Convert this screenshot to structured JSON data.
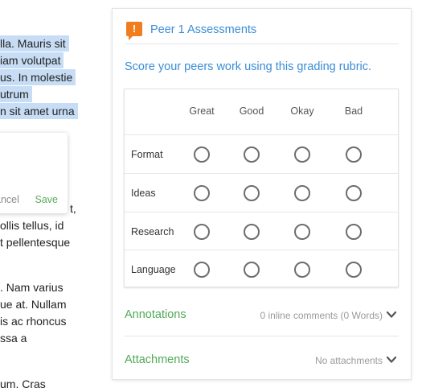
{
  "document": {
    "lines": [
      {
        "text": "lla. Mauris sit",
        "highlight": true
      },
      {
        "text": "iam volutpat",
        "highlight": true
      },
      {
        "text": "us. In molestie",
        "highlight": true
      },
      {
        "text": "utrum",
        "highlight": true
      },
      {
        "text": "n sit amet urna",
        "highlight": true
      },
      {
        "text": "t,",
        "highlight": false
      },
      {
        "text": "ollis tellus, id",
        "highlight": false
      },
      {
        "text": "t pellentesque",
        "highlight": false
      },
      {
        "text": ". Nam varius",
        "highlight": false
      },
      {
        "text": "ue at. Nullam",
        "highlight": false
      },
      {
        "text": "is ac rhoncus",
        "highlight": false
      },
      {
        "text": "ssa a",
        "highlight": false
      },
      {
        "text": "um. Cras",
        "highlight": false
      }
    ]
  },
  "comment_popup": {
    "cancel_label": "ancel",
    "save_label": "Save"
  },
  "card": {
    "title": "Peer 1 Assessments",
    "instructions": "Score your peers work using this grading rubric.",
    "rubric": {
      "columns": [
        "Great",
        "Good",
        "Okay",
        "Bad"
      ],
      "rows": [
        "Format",
        "Ideas",
        "Research",
        "Language"
      ]
    },
    "annotations": {
      "title": "Annotations",
      "meta": "0 inline comments (0 Words)"
    },
    "attachments": {
      "title": "Attachments",
      "meta": "No attachments"
    }
  },
  "colors": {
    "link_blue": "#3a8dd6",
    "section_green": "#4faa57",
    "alert_orange": "#f07d1e",
    "highlight": "#c7ddf5"
  },
  "icons": {
    "header": "alert-flag-icon",
    "expand": "chevron-down-icon"
  }
}
